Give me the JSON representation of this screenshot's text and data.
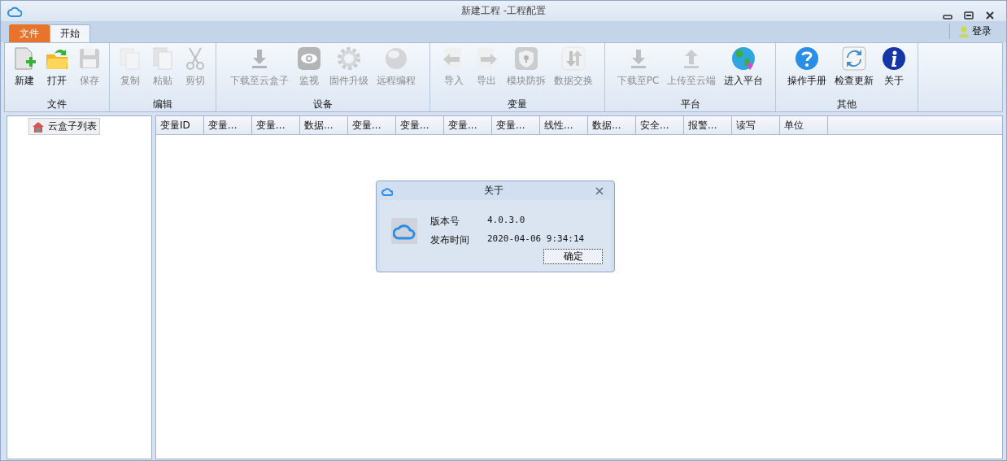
{
  "window": {
    "title": "新建工程 -工程配置"
  },
  "tabs": [
    {
      "label": "文件",
      "kind": "file",
      "selected": false
    },
    {
      "label": "开始",
      "kind": "normal",
      "selected": true
    }
  ],
  "login": {
    "label": "登录"
  },
  "ribbon": {
    "groups": [
      {
        "label": "文件",
        "buttons": [
          {
            "label": "新建",
            "disabled": false
          },
          {
            "label": "打开",
            "disabled": false
          },
          {
            "label": "保存",
            "disabled": true
          }
        ]
      },
      {
        "label": "编辑",
        "buttons": [
          {
            "label": "复制",
            "disabled": true
          },
          {
            "label": "粘贴",
            "disabled": true
          },
          {
            "label": "剪切",
            "disabled": true
          }
        ]
      },
      {
        "label": "设备",
        "buttons": [
          {
            "label": "下载至云盒子",
            "disabled": true
          },
          {
            "label": "监视",
            "disabled": true
          },
          {
            "label": "固件升级",
            "disabled": true
          },
          {
            "label": "远程编程",
            "disabled": true
          }
        ]
      },
      {
        "label": "变量",
        "buttons": [
          {
            "label": "导入",
            "disabled": true
          },
          {
            "label": "导出",
            "disabled": true
          },
          {
            "label": "模块防拆",
            "disabled": true
          },
          {
            "label": "数据交换",
            "disabled": true
          }
        ]
      },
      {
        "label": "平台",
        "buttons": [
          {
            "label": "下载至PC",
            "disabled": true
          },
          {
            "label": "上传至云端",
            "disabled": true
          },
          {
            "label": "进入平台",
            "disabled": false
          }
        ]
      },
      {
        "label": "其他",
        "buttons": [
          {
            "label": "操作手册",
            "disabled": false
          },
          {
            "label": "检查更新",
            "disabled": false
          },
          {
            "label": "关于",
            "disabled": false
          }
        ]
      }
    ]
  },
  "tree": {
    "items": [
      {
        "label": "云盒子列表",
        "selected": true
      }
    ]
  },
  "table": {
    "columns": [
      "变量ID",
      "变量...",
      "变量...",
      "数据...",
      "变量...",
      "变量...",
      "变量...",
      "变量...",
      "线性...",
      "数据...",
      "安全...",
      "报警...",
      "读写",
      "单位"
    ]
  },
  "dialog": {
    "title": "关于",
    "fields": [
      {
        "label": "版本号",
        "value": "4.0.3.0"
      },
      {
        "label": "发布时间",
        "value": "2020-04-06 9:34:14"
      }
    ],
    "ok_button": "确定"
  }
}
